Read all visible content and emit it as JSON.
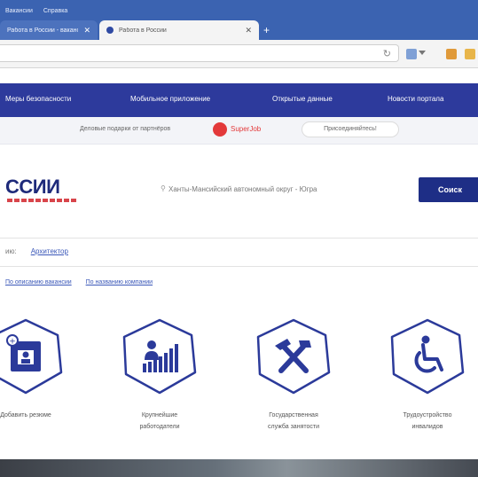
{
  "browser": {
    "menu": [
      "Вакансии",
      "Справка"
    ],
    "tabs": [
      {
        "label": "Работа в России - вакансии...",
        "active": false
      },
      {
        "label": "Работа в России",
        "active": true
      }
    ],
    "new_tab": "+",
    "reload": "↻"
  },
  "nav": {
    "items": [
      "Меры безопасности",
      "Мобильное приложение",
      "Открытые данные",
      "Новости портала"
    ]
  },
  "promo": {
    "text": "Деловые подарки от партнёров",
    "logo_text": "SuperJob",
    "button": "Присоединяйтесь!"
  },
  "header": {
    "logo": "ССИИ",
    "region": "Ханты-Мансийский автономный округ - Югра",
    "pin": "⚲",
    "search_button": "Соиск"
  },
  "breadcrumb": {
    "prefix": "ию:",
    "link": "Архитектор"
  },
  "sub_links": [
    "По описанию вакансии",
    "По названию компании"
  ],
  "cards": [
    {
      "label_1": "Добавить резюме",
      "label_2": "",
      "icon": "resume-icon"
    },
    {
      "label_1": "Крупнейшие",
      "label_2": "работодатели",
      "icon": "employers-chart-icon"
    },
    {
      "label_1": "Государственная",
      "label_2": "служба занятости",
      "icon": "tools-icon"
    },
    {
      "label_1": "Трудоустройство",
      "label_2": "инвалидов",
      "icon": "wheelchair-icon"
    }
  ],
  "colors": {
    "nav_bg": "#2d3a9c",
    "brand_dark": "#1e2e86",
    "accent_red": "#d8454b",
    "icon_blue": "#2b3a9a"
  }
}
